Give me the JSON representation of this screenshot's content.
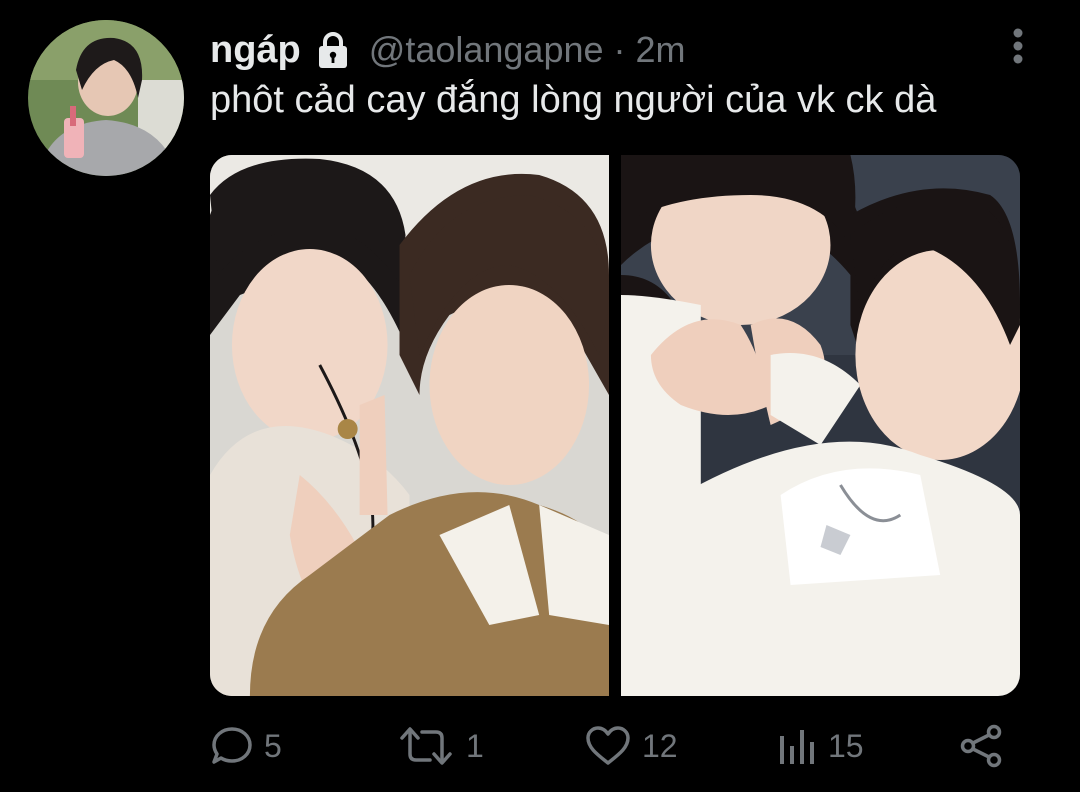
{
  "tweet": {
    "display_name": "ngáp",
    "handle": "@taolangapne",
    "separator": "·",
    "time": "2m",
    "text": "phôt cảd cay đắng lòng người của vk ck dà",
    "media": [
      {
        "name": "photo-1",
        "icon": "photo-image"
      },
      {
        "name": "photo-2",
        "icon": "photo-image"
      }
    ]
  },
  "actions": {
    "reply_count": "5",
    "retweet_count": "1",
    "like_count": "12",
    "views_count": "15"
  },
  "icons": {
    "lock": "lock-icon",
    "more": "more-vertical-icon",
    "reply": "speech-bubble-icon",
    "retweet": "retweet-arrows-icon",
    "like": "heart-icon",
    "views": "bar-chart-icon",
    "share": "share-nodes-icon"
  },
  "colors": {
    "background": "#000000",
    "primary_text": "#e7e9ea",
    "secondary_text": "#71767b"
  }
}
